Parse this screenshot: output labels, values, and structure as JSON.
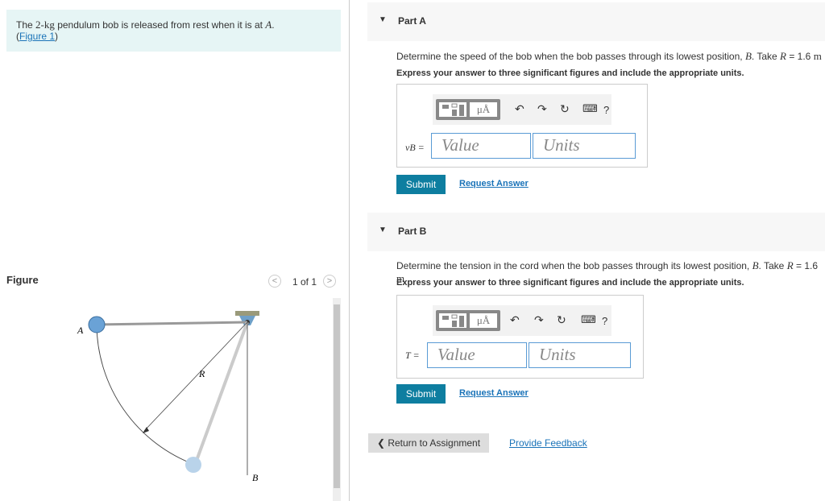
{
  "problem": {
    "text_prefix": "The ",
    "mass": "2-kg",
    "text_mid": " pendulum bob is released from rest when it is at ",
    "point": "A",
    "period": ".",
    "figure_link": "Figure 1",
    "paren_open": "(",
    "paren_close": ")"
  },
  "figure": {
    "title": "Figure",
    "pager": "1 of 1",
    "prev_icon": "chevron-left-icon",
    "next_icon": "chevron-right-icon",
    "labels": {
      "a": "A",
      "r": "R",
      "b": "B"
    }
  },
  "parts": [
    {
      "header": "Part A",
      "question_pre": "Determine the speed of the bob when the bob passes through its lowest position, ",
      "point": "B",
      "question_mid": ". Take ",
      "rvar": "R",
      "rval": " = 1.6 ",
      "unit": "m",
      "question_end": " .",
      "instruction": "Express your answer to three significant figures and include the appropriate units.",
      "var_label": "vB =",
      "value_placeholder": "Value",
      "units_placeholder": "Units",
      "submit": "Submit",
      "request": "Request Answer"
    },
    {
      "header": "Part B",
      "question_pre": "Determine the tension in the cord when the bob passes through its lowest position, ",
      "point": "B",
      "question_mid": ". Take ",
      "rvar": "R",
      "rval": " = 1.6 ",
      "unit": "m",
      "question_end": " .",
      "instruction": "Express your answer to three significant figures and include the appropriate units.",
      "var_label": "T =",
      "value_placeholder": "Value",
      "units_placeholder": "Units",
      "submit": "Submit",
      "request": "Request Answer"
    }
  ],
  "toolbar": {
    "mu_label": "μÅ",
    "help": "?",
    "undo": "↶",
    "redo": "↷",
    "reset": "↻",
    "keyboard": "⌨"
  },
  "footer": {
    "return_label": "Return to Assignment",
    "feedback": "Provide Feedback"
  },
  "colors": {
    "accent": "#0e7ea0",
    "link": "#1a73b8",
    "problem_bg": "#e6f5f5"
  }
}
